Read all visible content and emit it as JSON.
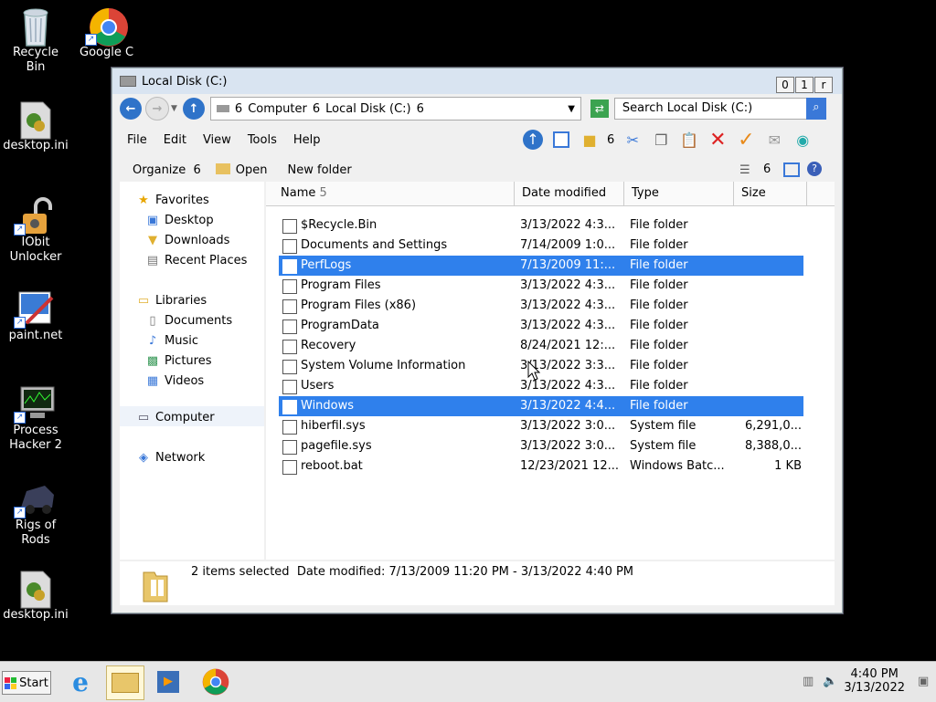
{
  "desktop": {
    "icons": [
      {
        "label": "Recycle Bin",
        "icon": "recycle-bin-icon"
      },
      {
        "label": "Google Chro",
        "icon": "chrome-icon"
      },
      {
        "label": "desktop.ini",
        "icon": "ini-file-icon"
      },
      {
        "label": "IObit Unlocker",
        "icon": "iobit-unlocker-icon"
      },
      {
        "label": "paint.net",
        "icon": "paint-net-icon"
      },
      {
        "label": "Process Hacker 2",
        "icon": "process-hacker-icon"
      },
      {
        "label": "Rigs of Rods",
        "icon": "rigs-of-rods-icon"
      },
      {
        "label": "desktop.ini",
        "icon": "ini-file-icon"
      }
    ]
  },
  "window": {
    "title": "Local Disk (C:)",
    "controls": [
      "0",
      "1",
      "r"
    ],
    "breadcrumb": [
      "6",
      "Computer",
      "6",
      "Local Disk (C:)",
      "6"
    ],
    "search_placeholder": "Search Local Disk (C:)",
    "menu": [
      "File",
      "Edit",
      "View",
      "Tools",
      "Help"
    ],
    "toolbar_glyph": "6",
    "commands": {
      "organize": "Organize",
      "organize_arrow": "6",
      "open": "Open",
      "new_folder": "New folder",
      "views_arrow": "6"
    },
    "nav": {
      "favorites": "Favorites",
      "desktop": "Desktop",
      "downloads": "Downloads",
      "recent": "Recent Places",
      "libraries": "Libraries",
      "documents": "Documents",
      "music": "Music",
      "pictures": "Pictures",
      "videos": "Videos",
      "computer": "Computer",
      "network": "Network"
    },
    "columns": {
      "name": "Name",
      "sort_glyph": "5",
      "date": "Date modified",
      "type": "Type",
      "size": "Size"
    },
    "files": [
      {
        "name": "$Recycle.Bin",
        "date": "3/13/2022 4:3...",
        "type": "File folder",
        "size": "",
        "selected": false
      },
      {
        "name": "Documents and Settings",
        "date": "7/14/2009 1:0...",
        "type": "File folder",
        "size": "",
        "selected": false
      },
      {
        "name": "PerfLogs",
        "date": "7/13/2009 11:...",
        "type": "File folder",
        "size": "",
        "selected": true
      },
      {
        "name": "Program Files",
        "date": "3/13/2022 4:3...",
        "type": "File folder",
        "size": "",
        "selected": false
      },
      {
        "name": "Program Files (x86)",
        "date": "3/13/2022 4:3...",
        "type": "File folder",
        "size": "",
        "selected": false
      },
      {
        "name": "ProgramData",
        "date": "3/13/2022 4:3...",
        "type": "File folder",
        "size": "",
        "selected": false
      },
      {
        "name": "Recovery",
        "date": "8/24/2021 12:...",
        "type": "File folder",
        "size": "",
        "selected": false
      },
      {
        "name": "System Volume Information",
        "date": "3/13/2022 3:3...",
        "type": "File folder",
        "size": "",
        "selected": false
      },
      {
        "name": "Users",
        "date": "3/13/2022 4:3...",
        "type": "File folder",
        "size": "",
        "selected": false
      },
      {
        "name": "Windows",
        "date": "3/13/2022 4:4...",
        "type": "File folder",
        "size": "",
        "selected": true
      },
      {
        "name": "hiberfil.sys",
        "date": "3/13/2022 3:0...",
        "type": "System file",
        "size": "6,291,0...",
        "selected": false
      },
      {
        "name": "pagefile.sys",
        "date": "3/13/2022 3:0...",
        "type": "System file",
        "size": "8,388,0...",
        "selected": false
      },
      {
        "name": "reboot.bat",
        "date": "12/23/2021 12...",
        "type": "Windows Batc...",
        "size": "1 KB",
        "selected": false
      }
    ],
    "details": "2 items selected  Date modified: 7/13/2009 11:20 PM - 3/13/2022 4:40 PM"
  },
  "taskbar": {
    "start": "Start",
    "time": "4:40 PM",
    "date": "3/13/2022"
  },
  "colors": {
    "selection": "#2f80ec",
    "desktop": "#000000"
  }
}
